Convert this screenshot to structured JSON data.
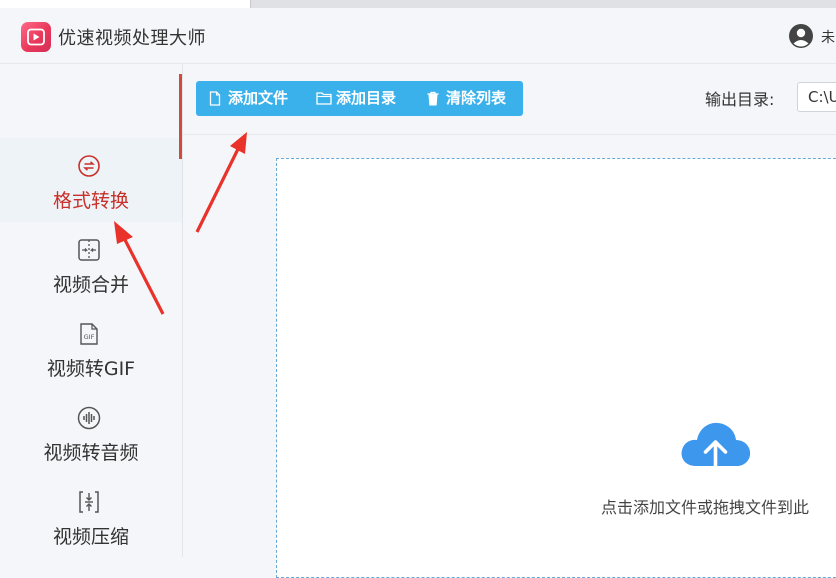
{
  "app": {
    "title": "优速视频处理大师",
    "user_name": "未"
  },
  "sidebar": {
    "items": [
      {
        "label": "格式转换",
        "icon": "format-convert-icon",
        "active": true
      },
      {
        "label": "视频合并",
        "icon": "video-merge-icon",
        "active": false
      },
      {
        "label": "视频转GIF",
        "icon": "gif-icon",
        "active": false
      },
      {
        "label": "视频转音频",
        "icon": "audio-wave-icon",
        "active": false
      },
      {
        "label": "视频压缩",
        "icon": "compress-icon",
        "active": false
      }
    ]
  },
  "toolbar": {
    "add_file": "添加文件",
    "add_folder": "添加目录",
    "clear_list": "清除列表"
  },
  "output": {
    "label": "输出目录:",
    "value": "C:\\U"
  },
  "dropzone": {
    "hint": "点击添加文件或拖拽文件到此"
  },
  "colors": {
    "accent": "#3bb1ec",
    "active_text": "#c8302a",
    "annotation_arrow": "#e8322a",
    "cloud": "#3d97ec"
  }
}
